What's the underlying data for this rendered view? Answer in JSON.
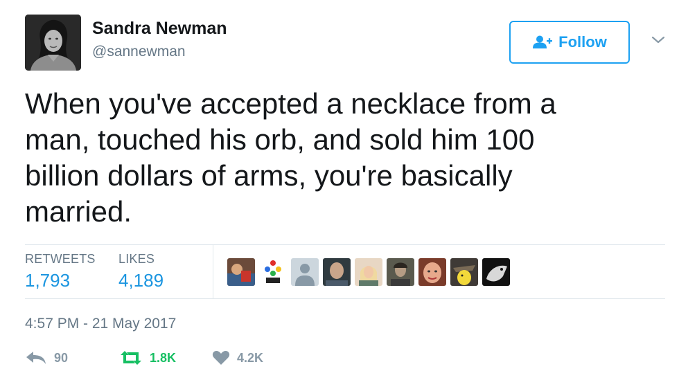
{
  "user": {
    "display_name": "Sandra Newman",
    "handle": "@sannewman"
  },
  "follow_button": {
    "label": "Follow",
    "icon": "follow-user-icon"
  },
  "tweet": {
    "lines": [
      "When you've accepted a necklace from a",
      "man, touched his orb, and sold him 100",
      "billion dollars of arms, you're basically",
      "married."
    ]
  },
  "stats": {
    "retweets_label": "RETWEETS",
    "retweets_value": "1,793",
    "likes_label": "LIKES",
    "likes_value": "4,189"
  },
  "timestamp": "4:57 PM - 21 May 2017",
  "actions": {
    "reply": {
      "icon": "reply-icon",
      "count": "90"
    },
    "retweet": {
      "icon": "retweet-icon",
      "count": "1.8K"
    },
    "like": {
      "icon": "heart-icon",
      "count": "4.2K"
    }
  },
  "colors": {
    "accent": "#1da1f2",
    "retweet_green": "#17bf63",
    "muted": "#657786",
    "text": "#14171a"
  }
}
